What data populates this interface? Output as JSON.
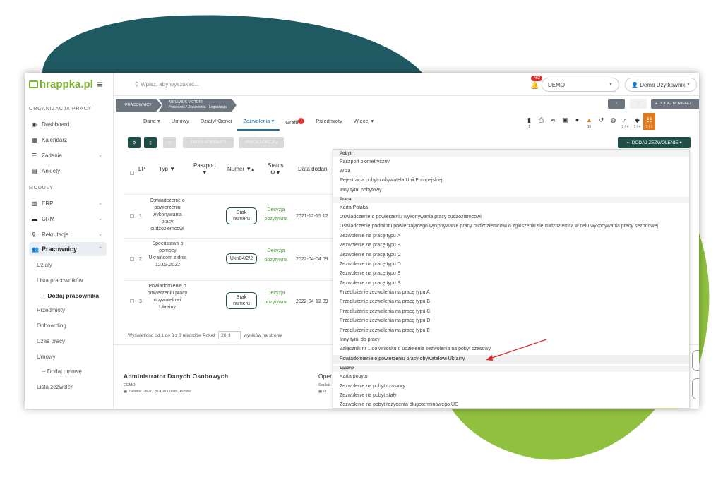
{
  "colors": {
    "accent": "#1e4e47",
    "brand_green": "#7ab32e",
    "link_blue": "#1b6fb5",
    "status_green": "#4b9a3a",
    "badge_red": "#e03030",
    "orange": "#e07a1f",
    "arrow_red": "#d9262a"
  },
  "brand": {
    "logo": "hrappka.pl"
  },
  "sidebar": {
    "section_org": "ORGANIZACJA PRACY",
    "items_org": [
      {
        "label": "Dashboard",
        "icon": "dashboard-icon"
      },
      {
        "label": "Kalendarz",
        "icon": "calendar-icon"
      },
      {
        "label": "Zadania",
        "icon": "tasks-icon"
      },
      {
        "label": "Ankiety",
        "icon": "survey-icon"
      }
    ],
    "section_mod": "MODUŁY",
    "items_mod": [
      {
        "label": "ERP",
        "icon": "erp-icon"
      },
      {
        "label": "CRM",
        "icon": "crm-icon"
      },
      {
        "label": "Rekrutacje",
        "icon": "search-icon"
      },
      {
        "label": "Pracownicy",
        "icon": "users-icon"
      }
    ],
    "subitems": [
      "Działy",
      "Lista pracowników",
      "Dodaj pracownika",
      "Przedmioty",
      "Onboarding",
      "Czas pracy",
      "Umowy",
      "Dodaj umowę",
      "Lista zezwoleń"
    ]
  },
  "topbar": {
    "search_placeholder": "Wpisz, aby wyszukać...",
    "notif_count": "762",
    "company": "DEMO",
    "user": "Demo Użytkownik"
  },
  "breadcrumb": {
    "root": "PRACOWNICY",
    "name": "ABRAMIUK VICTORII",
    "path": "Pracownik / Zezwolenia - Legalizacja"
  },
  "header_buttons": {
    "add_new": "DODAJ NOWEGO"
  },
  "tabs": [
    "Dane",
    "Umowy",
    "Działy/Klienci",
    "Zezwolenia",
    "Grafik",
    "Przedmioty",
    "Więcej"
  ],
  "tab_badge": "1",
  "toolbar_counts": {
    "doc": "1",
    "bell": "16",
    "clip": "2 / 4",
    "tag": "1 / 4",
    "orange": "1 / 1"
  },
  "table_toolbar": {
    "change_attr": "ZMIEŃ ATRYBUTY",
    "more": "WIĘCEJ OPCJI",
    "add_permit": "DODAJ ZEZWOLENIE"
  },
  "table": {
    "headers": [
      "LP",
      "Typ",
      "Paszport",
      "Numer",
      "Status",
      "Data dodani"
    ],
    "rows": [
      {
        "lp": "1",
        "typ": "Oświadczenie o powierzeniu wykonywania pracy cudzoziemcowi",
        "numer": "Brak numeru",
        "status": "Decyzja pozytywna",
        "data": "2021-12-15 12"
      },
      {
        "lp": "2",
        "typ": "Specustawa o pomocy Ukraińcom z dnia 12.03.2022",
        "numer": "Ukr/04/2/2",
        "status": "Decyzja pozytywna",
        "data": "2022-04-04 09"
      },
      {
        "lp": "3",
        "typ": "Powiadomienie o powierzeniu pracy obywatelowi Ukrainy",
        "numer": "Brak numeru",
        "status": "Decyzja pozytywna",
        "data": "2022-04-12 09"
      }
    ],
    "footer_pre": "Wyświetlono od 1 do 3 z 3 rekordów  Pokaż",
    "page_size": "20",
    "footer_post": "wyników na stronie"
  },
  "footer": {
    "admin_title": "Administrator Danych Osobowych",
    "admin_company": "DEMO",
    "admin_address": "Zielona 186/7, 20-100 Lublin, Polska",
    "oper_title": "Oper",
    "oper_sub1": "Soulab",
    "oper_sub2": "ul"
  },
  "dropdown": {
    "groups": [
      {
        "label": "Pobyt",
        "items": [
          "Paszport biometryczny",
          "Wiza",
          "Rejestracja pobytu obywatela Unii Europejskiej",
          "Inny tytuł pobytowy"
        ]
      },
      {
        "label": "Praca",
        "items": [
          "Karta Polaka",
          "Oświadczenie o powierzeniu wykonywania pracy cudzoziemcowi",
          "Oświadczenie podmiotu powierzającego wykonywanie pracy cudzoziemcowi o zgłoszeniu się cudzoziemca w celu wykonywania pracy sezonowej",
          "Zezwolenie na pracę typu A",
          "Zezwolenie na pracę typu B",
          "Zezwolenie na pracę typu C",
          "Zezwolenie na pracę typu D",
          "Zezwolenie na pracę typu E",
          "Zezwolenie na pracę typu S",
          "Przedłużenie zezwolenia na pracę typu A",
          "Przedłużenie zezwolenia na pracę typu B",
          "Przedłużenie zezwolenia na pracę typu C",
          "Przedłużenie zezwolenia na pracę typu D",
          "Przedłużenie zezwolenia na pracę typu E",
          "Inny tytuł do pracy",
          "Załącznik nr 1 do wniosku o udzielenie zezwolenia na pobyt czasowy",
          "Powiadomienie o powierzeniu pracy obywatelowi Ukrainy"
        ]
      },
      {
        "label": "Łączne",
        "items": [
          "Karta pobytu",
          "Zezwolenie na pobyt czasowy",
          "Zezwolenie na pobyt stały",
          "Zezwolenie na pobyt rezydenta długoterminowego UE"
        ]
      }
    ],
    "highlighted": "Powiadomienie o powierzeniu pracy obywatelowi Ukrainy"
  }
}
